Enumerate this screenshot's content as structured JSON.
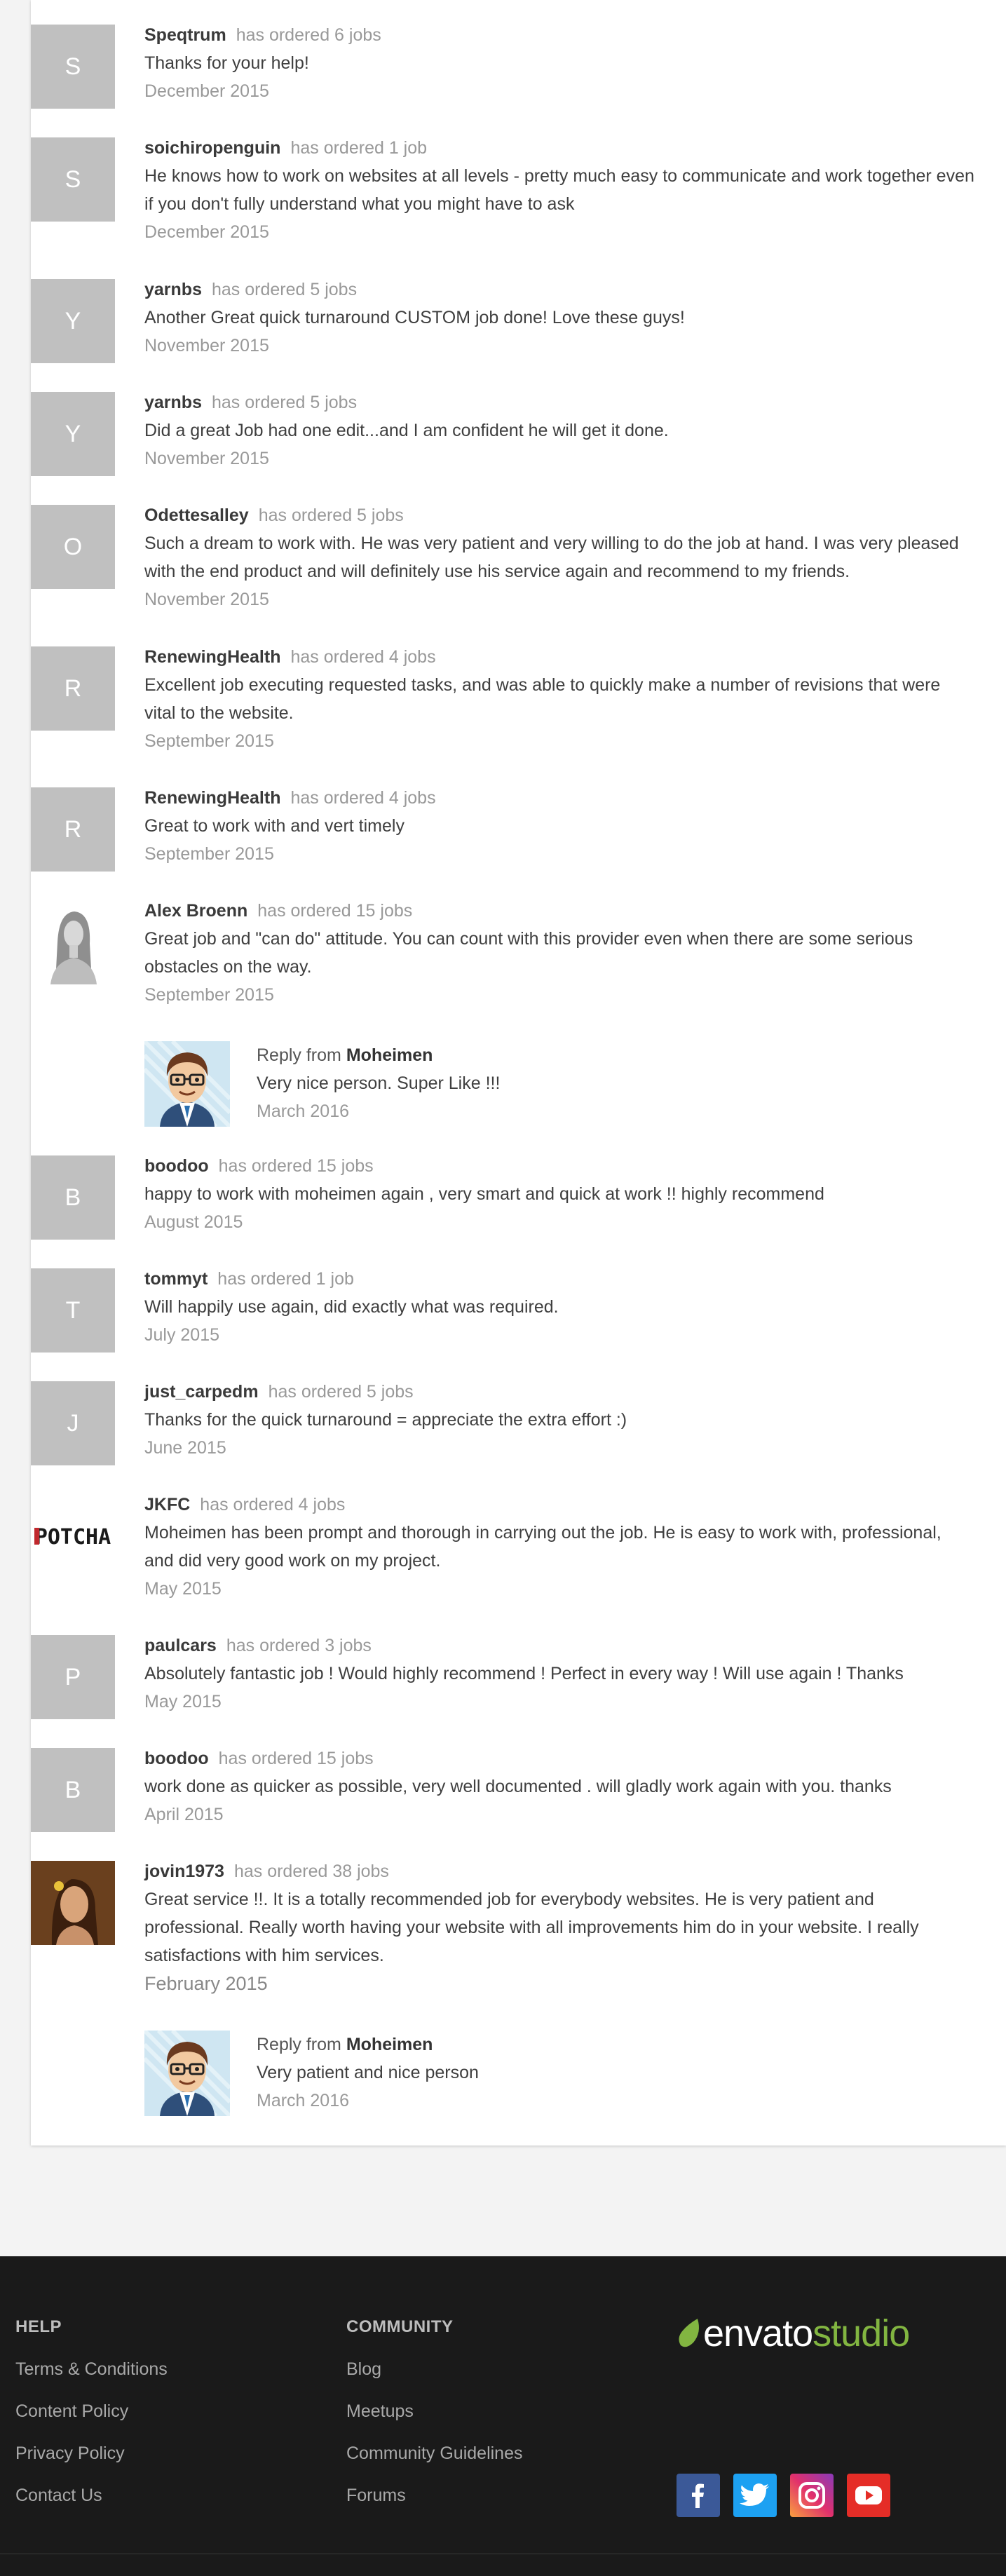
{
  "reviews": [
    {
      "initial": "S",
      "name": "Speqtrum",
      "ordered": "has ordered 6 jobs",
      "text": "Thanks for your help!",
      "date": "December 2015"
    },
    {
      "initial": "S",
      "name": "soichiropenguin",
      "ordered": "has ordered 1 job",
      "text": "He knows how to work on websites at all levels - pretty much easy to communicate and work together even if you don't fully understand what you might have to ask",
      "date": "December 2015"
    },
    {
      "initial": "Y",
      "name": "yarnbs",
      "ordered": "has ordered 5 jobs",
      "text": "Another Great quick turnaround CUSTOM job done! Love these guys!",
      "date": "November 2015"
    },
    {
      "initial": "Y",
      "name": "yarnbs",
      "ordered": "has ordered 5 jobs",
      "text": "Did a great Job had one edit...and I am confident he will get it done.",
      "date": "November 2015"
    },
    {
      "initial": "O",
      "name": "Odettesalley",
      "ordered": "has ordered 5 jobs",
      "text": "Such a dream to work with. He was very patient and very willing to do the job at hand. I was very pleased with the end product and will definitely use his service again and recommend to my friends.",
      "date": "November 2015"
    },
    {
      "initial": "R",
      "name": "RenewingHealth",
      "ordered": "has ordered 4 jobs",
      "text": "Excellent job executing requested tasks, and was able to quickly make a number of revisions that were vital to the website.",
      "date": "September 2015"
    },
    {
      "initial": "R",
      "name": "RenewingHealth",
      "ordered": "has ordered 4 jobs",
      "text": "Great to work with and vert timely",
      "date": "September 2015"
    },
    {
      "initial": "",
      "name": "Alex Broenn",
      "ordered": "has ordered 15 jobs",
      "text": "Great job and \"can do\" attitude. You can count with this provider even when there are some serious obstacles on the way.",
      "date": "September 2015"
    },
    {
      "initial": "B",
      "name": "boodoo",
      "ordered": "has ordered 15 jobs",
      "text": "happy to work with moheimen again , very smart and quick at work !! highly recommend",
      "date": "August 2015"
    },
    {
      "initial": "T",
      "name": "tommyt",
      "ordered": "has ordered 1 job",
      "text": "Will happily use again, did exactly what was required.",
      "date": "July 2015"
    },
    {
      "initial": "J",
      "name": "just_carpedm",
      "ordered": "has ordered 5 jobs",
      "text": "Thanks for the quick turnaround = appreciate the extra effort :)",
      "date": "June 2015"
    },
    {
      "initial": "",
      "name": "JKFC",
      "ordered": "has ordered 4 jobs",
      "text": "Moheimen has been prompt and thorough in carrying out the job. He is easy to work with, professional, and did very good work on my project.",
      "date": "May 2015",
      "logo_text": "POTCHA"
    },
    {
      "initial": "P",
      "name": "paulcars",
      "ordered": "has ordered 3 jobs",
      "text": "Absolutely fantastic job ! Would highly recommend ! Perfect in every way ! Will use again ! Thanks",
      "date": "May 2015"
    },
    {
      "initial": "B",
      "name": "boodoo",
      "ordered": "has ordered 15 jobs",
      "text": "work done as quicker as possible, very well documented . will gladly work again with you. thanks",
      "date": "April 2015"
    },
    {
      "initial": "",
      "name": "jovin1973",
      "ordered": "has ordered 38 jobs",
      "text": "Great service !!. It is a totally recommended job for everybody websites. He is very patient and professional. Really worth having your website with all improvements him do in your website. I really satisfactions with him services.",
      "date": "February 2015"
    }
  ],
  "replies": [
    {
      "prefix": "Reply from",
      "author": "Moheimen",
      "text": "Very nice person. Super Like !!!",
      "date": "March 2016"
    },
    {
      "prefix": "Reply from",
      "author": "Moheimen",
      "text": "Very patient and nice person",
      "date": "March 2016"
    }
  ],
  "footer": {
    "help": {
      "heading": "HELP",
      "links": [
        "Terms & Conditions",
        "Content Policy",
        "Privacy Policy",
        "Contact Us"
      ]
    },
    "community": {
      "heading": "COMMUNITY",
      "links": [
        "Blog",
        "Meetups",
        "Community Guidelines",
        "Forums"
      ]
    },
    "logo": {
      "part1": "envato",
      "part2": "studio"
    },
    "social_icons": [
      "facebook-icon",
      "twitter-icon",
      "instagram-icon",
      "youtube-icon"
    ],
    "colors": {
      "facebook": "#3b5998",
      "twitter": "#1da1f2",
      "youtube": "#e52d27",
      "brand_green": "#82b541"
    }
  }
}
